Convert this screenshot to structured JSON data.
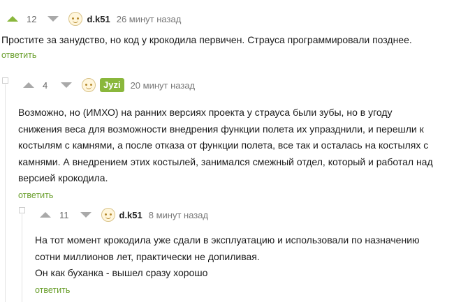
{
  "comments": [
    {
      "rating": "12",
      "user": "d.k51",
      "time": "26 минут назад",
      "text": "Простите за занудство, но код у крокодила первичен. Страуса программировали позднее.",
      "reply_label": "ответить"
    },
    {
      "rating": "4",
      "user": "Jyzi",
      "time": "20 минут назад",
      "text": "Возможно, но (ИМХО) на ранних версиях проекта у страуса были зубы, но в угоду снижения веса для возможности внедрения функции полета их упразднили, и перешли к костылям с камнями, а после отказа от функции полета, все так и осталась на костылях с камнями. А внедрением этих костылей, занимался смежный отдел, который и работал над версией крокодила.",
      "reply_label": "ответить"
    },
    {
      "rating": "11",
      "user": "d.k51",
      "time": "8 минут назад",
      "lines": [
        "На тот момент крокодила уже сдали в эксплуатацию и использовали по назначению",
        "сотни миллионов лет, практически не допиливая.",
        "Он как буханка - вышел сразу хорошо"
      ],
      "reply_label": "ответить"
    }
  ],
  "colors": {
    "accent": "#8ab73c",
    "reply": "#6a9f2d",
    "arrow": "#a9a9a9"
  }
}
